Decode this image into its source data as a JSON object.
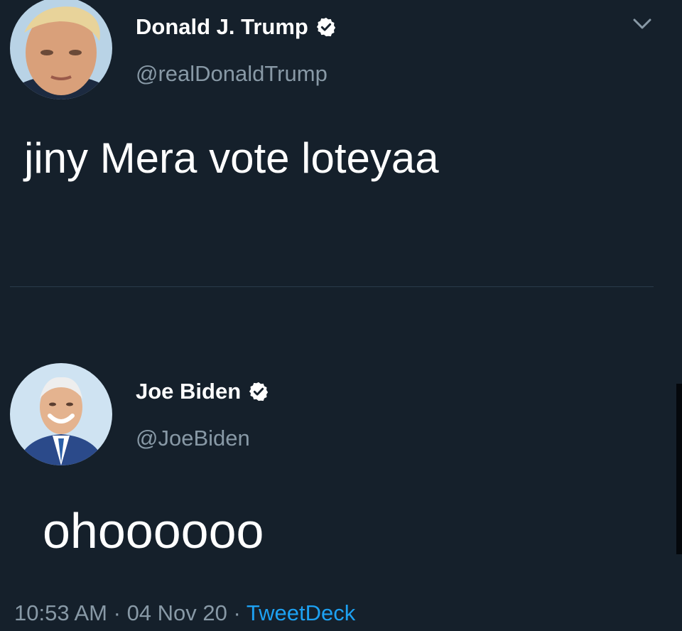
{
  "tweet_top": {
    "author_name": "Donald J. Trump",
    "handle": "@realDonaldTrump",
    "verified": true,
    "text": "jiny Mera vote loteyaa"
  },
  "tweet_bottom": {
    "author_name": "Joe Biden",
    "handle": "@JoeBiden",
    "verified": true,
    "text": "ohoooooo"
  },
  "meta": {
    "time": "10:53 AM",
    "separator": "·",
    "date": "04 Nov 20",
    "source": "TweetDeck"
  },
  "icons": {
    "verified": "verified-badge-icon",
    "menu": "chevron-down-icon"
  },
  "colors": {
    "background": "#15202b",
    "text": "#ffffff",
    "secondary_text": "#8899a6",
    "link": "#1da1f2",
    "divider": "#2a3a4a"
  }
}
